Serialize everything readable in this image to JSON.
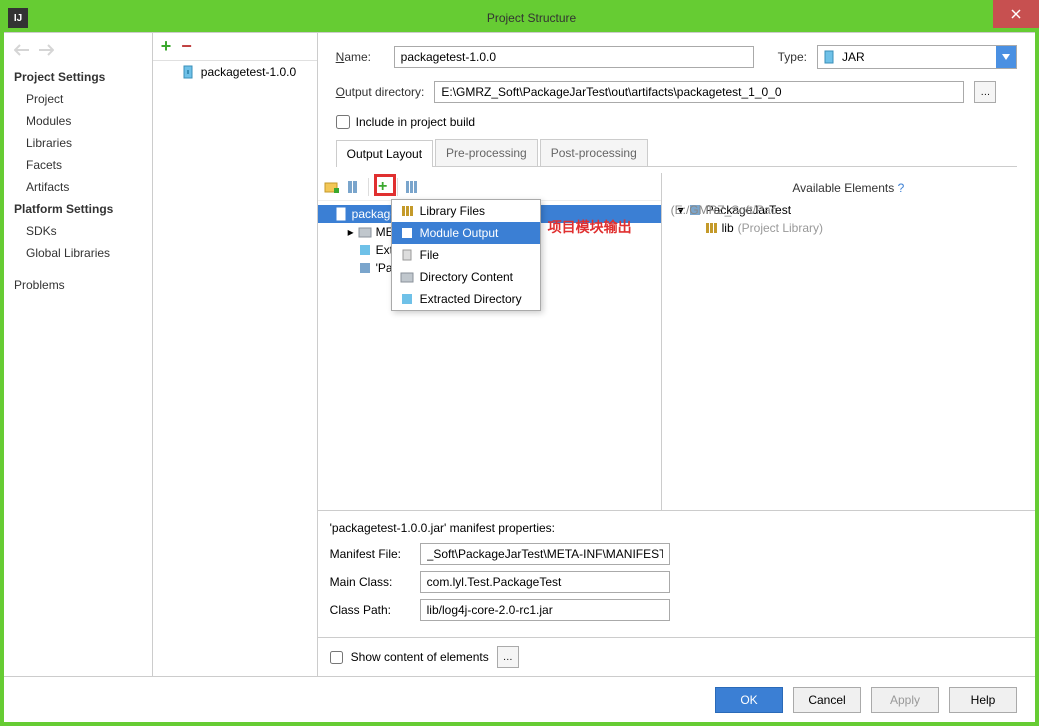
{
  "window_title": "Project Structure",
  "sidebar_left": {
    "section1": "Project Settings",
    "items1": [
      "Project",
      "Modules",
      "Libraries",
      "Facets",
      "Artifacts"
    ],
    "section2": "Platform Settings",
    "items2": [
      "SDKs",
      "Global Libraries"
    ],
    "problems": "Problems"
  },
  "mid_item": "packagetest-1.0.0",
  "name_label": "Name:",
  "name_value": "packagetest-1.0.0",
  "type_label": "Type:",
  "type_value": "JAR",
  "outdir_label": "Output directory:",
  "outdir_value": "E:\\GMRZ_Soft\\PackageJarTest\\out\\artifacts\\packagetest_1_0_0",
  "include_label": "Include in project build",
  "tabs": {
    "t1": "Output Layout",
    "t2": "Pre-processing",
    "t3": "Post-processing"
  },
  "tree": {
    "root": "packaget",
    "meta": "META-",
    "extract": "Extrac",
    "pack2": "'Packa..."
  },
  "popup": {
    "library": "Library Files",
    "module": "Module Output",
    "file": "File",
    "dir": "Directory Content",
    "extracted": "Extracted Directory"
  },
  "annotation": "项目模块输出",
  "avail": {
    "head": "Available Elements",
    "q": "?",
    "proj": "PackageJarTest",
    "lib": "lib",
    "libnote": "(Project Library)"
  },
  "selected_hint": "(E:/GMRZ_Soft/Pac",
  "manifest": {
    "title": "'packagetest-1.0.0.jar' manifest properties:",
    "mf_label": "Manifest File:",
    "mf_value": "_Soft\\PackageJarTest\\META-INF\\MANIFEST",
    "main_label": "Main Class:",
    "main_value": "com.lyl.Test.PackageTest",
    "cp_label": "Class Path:",
    "cp_value": "lib/log4j-core-2.0-rc1.jar"
  },
  "show_content": "Show content of elements",
  "buttons": {
    "ok": "OK",
    "cancel": "Cancel",
    "apply": "Apply",
    "help": "Help"
  }
}
